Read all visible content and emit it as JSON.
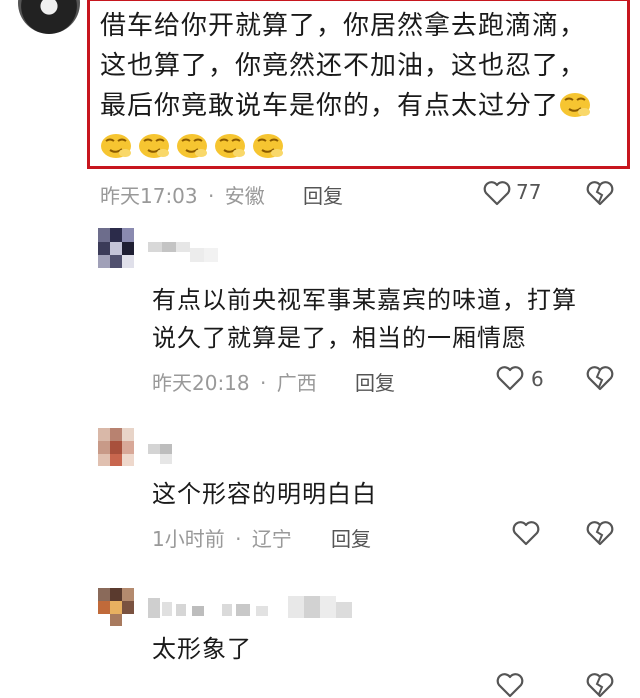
{
  "main_comment": {
    "lines": [
      "借车给你开就算了，你居然拿去跑滴滴，",
      "这也算了，你竟然还不加油，这也忍了，",
      "最后你竟敢说车是你的，有点太过分了"
    ],
    "emoji": "smirk-emoji",
    "emoji_count": 6,
    "time": "昨天17:03",
    "location": "安徽",
    "reply": "回复",
    "likes": "77"
  },
  "replies": [
    {
      "lines": [
        "有点以前央视军事某嘉宾的味道，打算",
        "说久了就算是了，相当的一厢情愿"
      ],
      "time": "昨天20:18",
      "location": "广西",
      "reply": "回复",
      "likes": "6"
    },
    {
      "lines": [
        "这个形容的明明白白"
      ],
      "time": "1小时前",
      "location": "辽宁",
      "reply": "回复",
      "likes": ""
    },
    {
      "lines": [
        "太形象了"
      ],
      "time": "",
      "location": "",
      "reply": "",
      "likes": ""
    }
  ],
  "separator": "·",
  "colors": {
    "highlight_border": "#c7161e",
    "meta_text": "#999999",
    "body_text": "#1a1a1a"
  }
}
